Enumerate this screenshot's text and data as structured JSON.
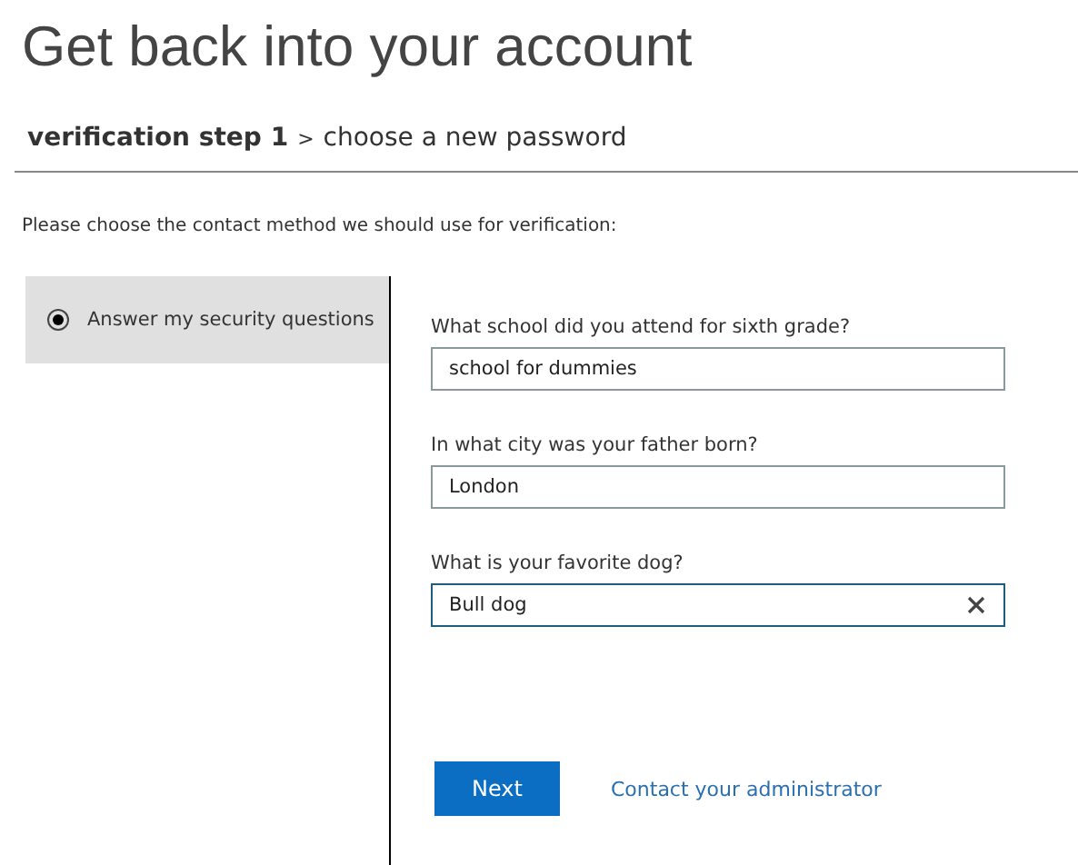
{
  "title": "Get back into your account",
  "breadcrumb": {
    "current": "verification step 1",
    "separator": ">",
    "next": "choose a new password"
  },
  "instruction": "Please choose the contact method we should use for verification:",
  "methods": [
    {
      "label": "Answer my security questions",
      "selected": true
    }
  ],
  "questions": [
    {
      "label": "What school did you attend for sixth grade?",
      "value": "school for dummies",
      "focused": false
    },
    {
      "label": "In what city was your father born?",
      "value": "London",
      "focused": false
    },
    {
      "label": "What is your favorite dog?",
      "value": "Bull dog",
      "focused": true
    }
  ],
  "next_button": "Next",
  "admin_link": "Contact your administrator"
}
